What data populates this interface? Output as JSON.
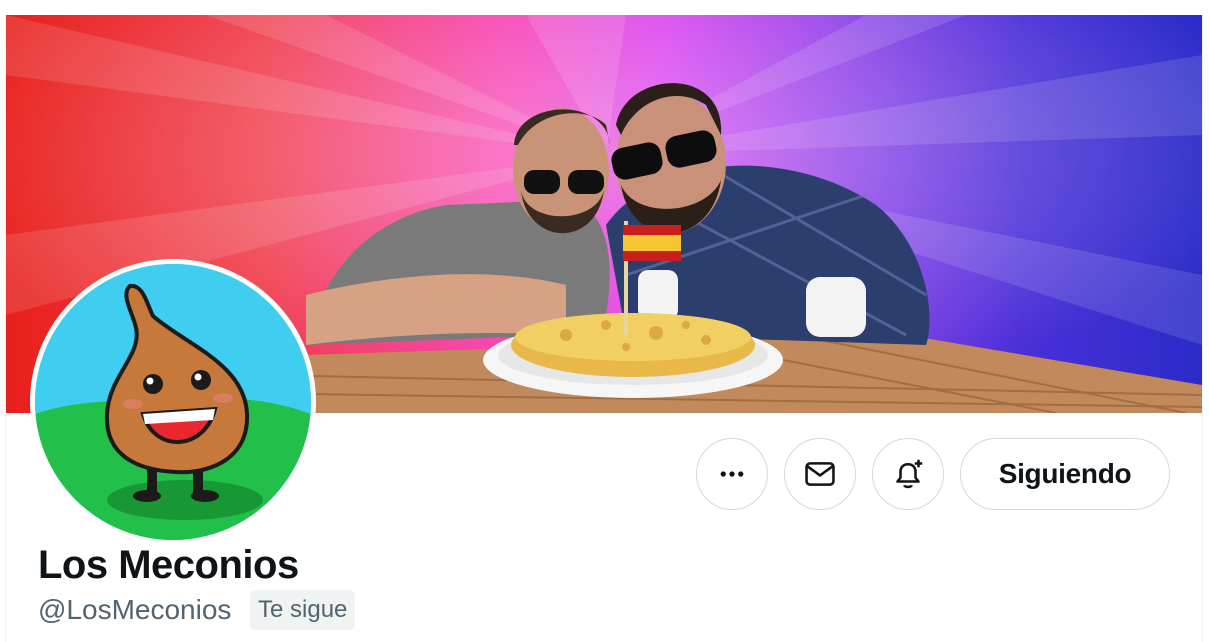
{
  "profile": {
    "name": "Los Meconios",
    "handle": "@LosMeconios",
    "follows_you_badge": "Te sigue"
  },
  "actions": {
    "more_icon": "more-horizontal-icon",
    "message_icon": "envelope-icon",
    "notify_icon": "bell-plus-icon",
    "follow_label": "Siguiendo"
  },
  "colors": {
    "text_primary": "#0f1419",
    "text_secondary": "#536471",
    "border": "#cfd9de",
    "badge_bg": "#eff3f4"
  }
}
